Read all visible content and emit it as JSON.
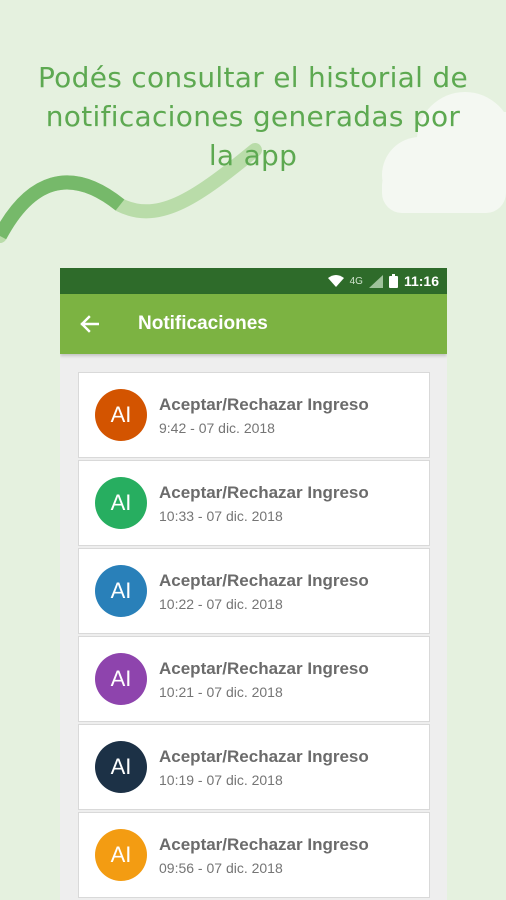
{
  "promo": {
    "line1": "Podés consultar el historial de",
    "line2": "notificaciones generadas por",
    "line3": "la app"
  },
  "status_bar": {
    "network": "4G",
    "time": "11:16"
  },
  "toolbar": {
    "title": "Notificaciones",
    "back_icon": "arrow-back-icon"
  },
  "notifications": [
    {
      "initials": "AI",
      "title": "Aceptar/Rechazar Ingreso",
      "time": "9:42 - 07 dic. 2018",
      "color": "#d35400"
    },
    {
      "initials": "AI",
      "title": "Aceptar/Rechazar Ingreso",
      "time": "10:33 - 07 dic. 2018",
      "color": "#27ae60"
    },
    {
      "initials": "AI",
      "title": "Aceptar/Rechazar Ingreso",
      "time": "10:22 - 07 dic. 2018",
      "color": "#2980b9"
    },
    {
      "initials": "AI",
      "title": "Aceptar/Rechazar Ingreso",
      "time": "10:21 - 07 dic. 2018",
      "color": "#8e44ad"
    },
    {
      "initials": "AI",
      "title": "Aceptar/Rechazar Ingreso",
      "time": "10:19 - 07 dic. 2018",
      "color": "#1c3146"
    },
    {
      "initials": "AI",
      "title": "Aceptar/Rechazar Ingreso",
      "time": "09:56 - 07 dic. 2018",
      "color": "#f39c12"
    }
  ],
  "colors": {
    "background": "#e5f1df",
    "accent_text": "#5da951",
    "toolbar": "#7cb342",
    "status_bar": "#2e6b2a"
  }
}
